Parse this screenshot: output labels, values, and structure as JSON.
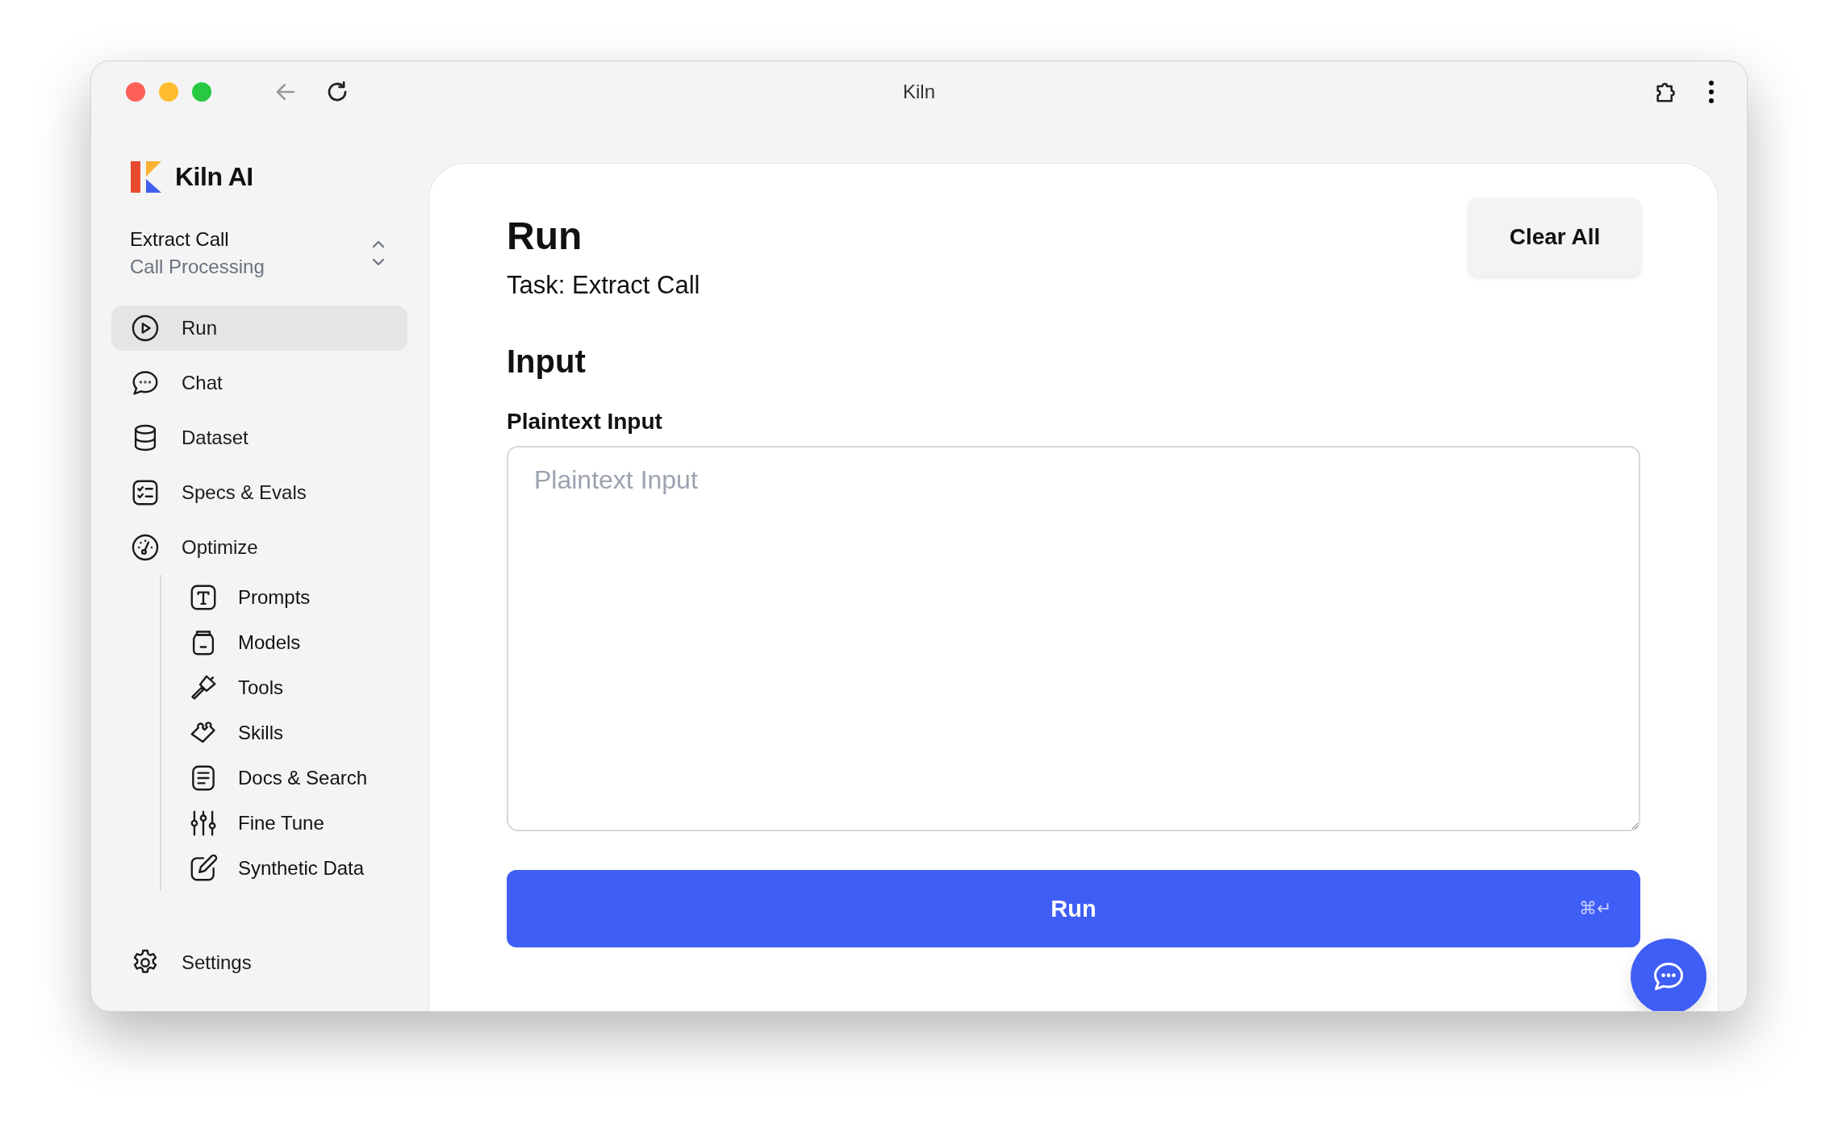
{
  "window": {
    "title": "Kiln"
  },
  "sidebar": {
    "logo_text": "Kiln AI",
    "project": {
      "name": "Extract Call",
      "subtitle": "Call Processing"
    },
    "items": [
      {
        "label": "Run",
        "selected": true
      },
      {
        "label": "Chat",
        "selected": false
      },
      {
        "label": "Dataset",
        "selected": false
      },
      {
        "label": "Specs & Evals",
        "selected": false
      },
      {
        "label": "Optimize",
        "selected": false,
        "children": [
          {
            "label": "Prompts",
            "selected": false
          },
          {
            "label": "Models",
            "selected": false
          },
          {
            "label": "Tools",
            "selected": false
          },
          {
            "label": "Skills",
            "selected": false
          },
          {
            "label": "Docs & Search",
            "selected": false
          },
          {
            "label": "Fine Tune",
            "selected": false
          },
          {
            "label": "Synthetic Data",
            "selected": false
          }
        ]
      }
    ],
    "footer_item": {
      "label": "Settings",
      "selected": false
    }
  },
  "main": {
    "title": "Run",
    "subtitle": "Task: Extract Call",
    "clear_button": "Clear All",
    "section_title": "Input",
    "field": {
      "label": "Plaintext Input",
      "placeholder": "Plaintext Input"
    },
    "run_button": {
      "label": "Run",
      "shortcut": "⌘↵"
    }
  }
}
